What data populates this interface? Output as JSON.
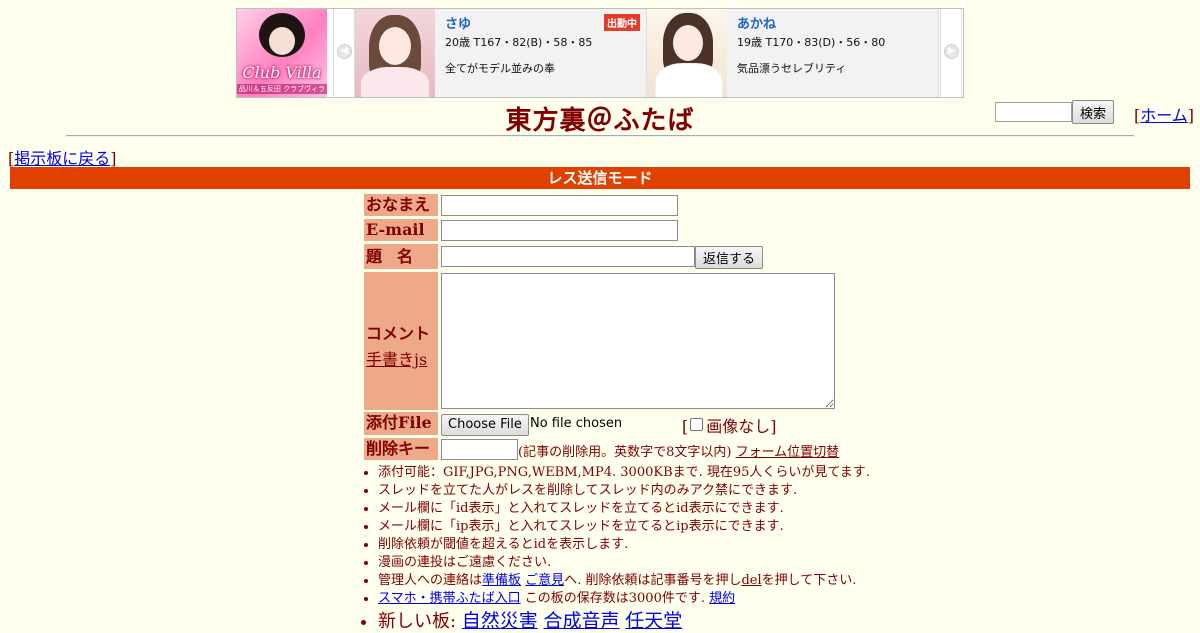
{
  "ad": {
    "logo_text": "Club Villa",
    "logo_sub": "品川＆五反田 クラブヴィラ",
    "cards": [
      {
        "name": "さゆ",
        "stats": "20歳 T167・82(B)・58・85",
        "desc": "全てがモデル並みの奉",
        "badge": "出勤中"
      },
      {
        "name": "あかね",
        "stats": "19歳 T170・83(D)・56・80",
        "desc": "気品漂うセレブリティ"
      }
    ],
    "prev_icon": "chevron-left-icon",
    "next_icon": "chevron-right-icon"
  },
  "header": {
    "title": "東方裏＠ふたば",
    "search_button": "検索",
    "search_value": "",
    "home_link": "ホーム",
    "bracket_open": "[",
    "bracket_close": "]"
  },
  "nav": {
    "back_link": "掲示板に戻る"
  },
  "mode_bar": "レス送信モード",
  "form": {
    "name_label": "おなまえ",
    "email_label": "E-mail",
    "subject_label": "題名",
    "submit_button": "返信する",
    "comment_label": "コメント",
    "handwrite_link": "手書きjs",
    "file_label": "添付File",
    "file_button": "Choose File",
    "file_status": "No file chosen",
    "no_image_label": "画像なし",
    "delkey_label": "削除キー",
    "delkey_note": "(記事の削除用。英数字で8文字以内)",
    "form_position_link": "フォーム位置切替"
  },
  "rules": {
    "line1": "添付可能：GIF,JPG,PNG,WEBM,MP4. 3000KBまで. 現在95人くらいが見てます.",
    "line2": "スレッドを立てた人がレスを削除してスレッド内のみアク禁にできます.",
    "line3": "メール欄に「id表示」と入れてスレッドを立てるとid表示にできます.",
    "line4": "メール欄に「ip表示」と入れてスレッドを立てるとip表示にできます.",
    "line5": "削除依頼が閾値を超えるとidを表示します.",
    "line6": "漫画の連投はご遠慮ください.",
    "line7_a": "管理人への連絡は",
    "line7_link1": "準備板",
    "line7_link2": "ご意見",
    "line7_b": "へ. 削除依頼は記事番号を押し",
    "line7_link3": "del",
    "line7_c": "を押して下さい.",
    "line8_link1": "スマホ・携帯ふたば入口",
    "line8_b": " この板の保存数は3000件です.",
    "line8_link2": "規約",
    "line9_a": "新しい板: ",
    "line9_link1": "自然災害",
    "line9_link2": "合成音声",
    "line9_link3": "任天堂"
  }
}
